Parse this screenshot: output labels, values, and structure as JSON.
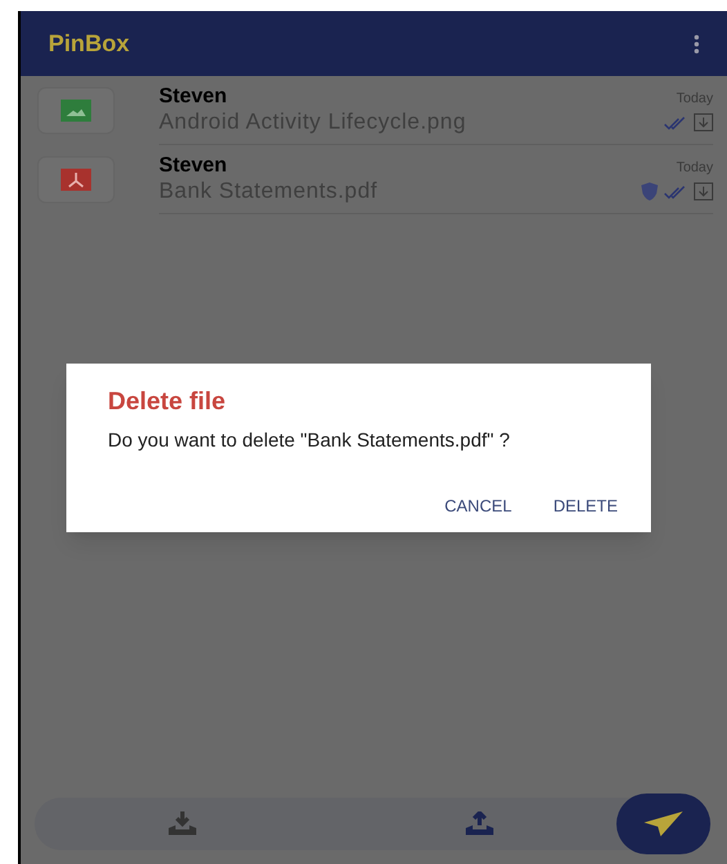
{
  "app_bar": {
    "title": "PinBox"
  },
  "files": [
    {
      "sender": "Steven",
      "name": "Android Activity Lifecycle.png",
      "date": "Today",
      "kind": "image",
      "protected": false
    },
    {
      "sender": "Steven",
      "name": "Bank Statements.pdf",
      "date": "Today",
      "kind": "pdf",
      "protected": true
    }
  ],
  "dialog": {
    "title": "Delete file",
    "message": "Do you want to delete \"Bank Statements.pdf\" ?",
    "buttons": [
      "CANCEL",
      "DELETE"
    ]
  }
}
